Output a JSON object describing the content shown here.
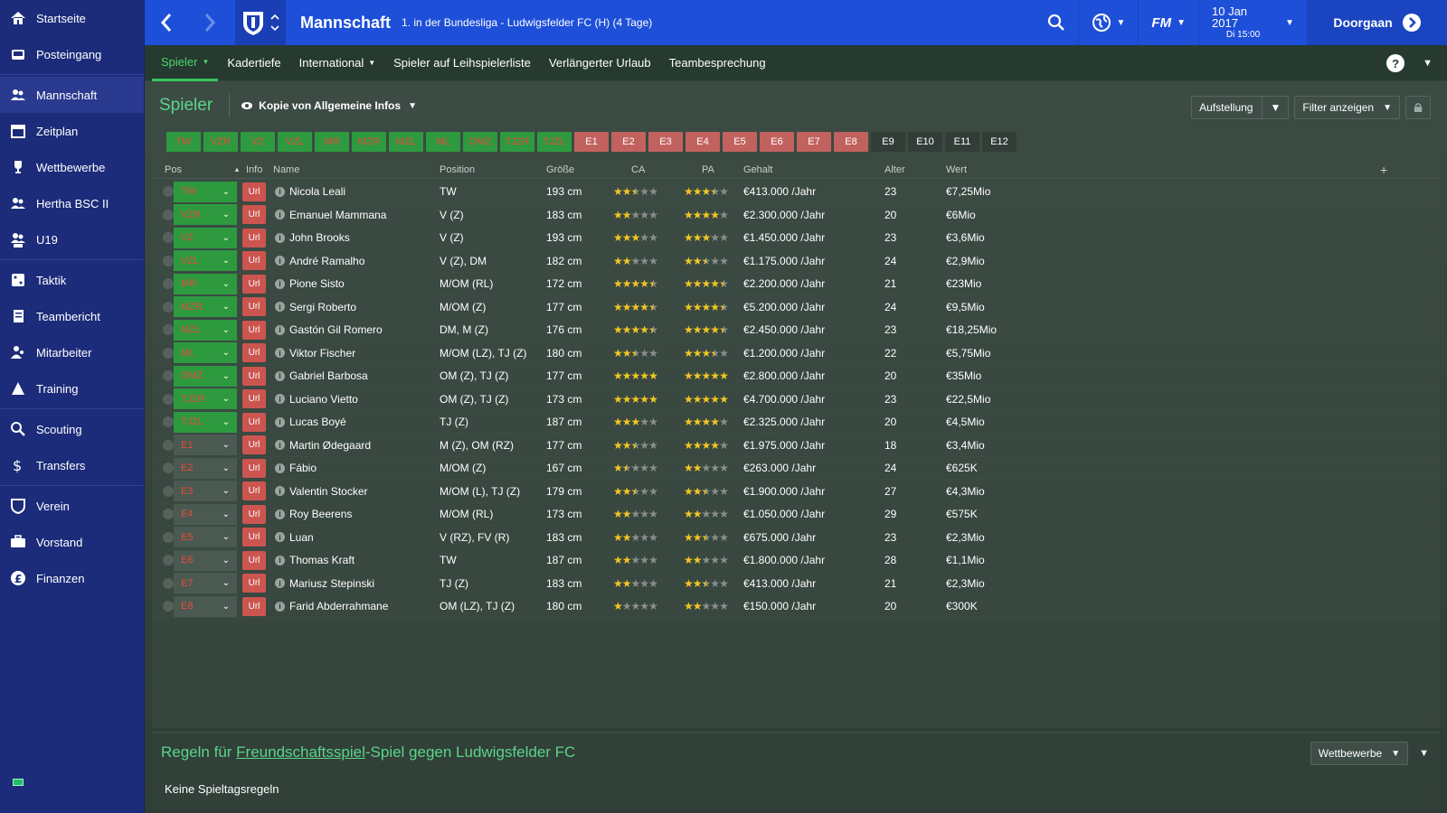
{
  "sidebar": {
    "items": [
      {
        "label": "Startseite",
        "icon": "home-icon"
      },
      {
        "label": "Posteingang",
        "icon": "inbox-icon"
      },
      {
        "label": "Mannschaft",
        "icon": "team-icon",
        "active": true
      },
      {
        "label": "Zeitplan",
        "icon": "calendar-icon"
      },
      {
        "label": "Wettbewerbe",
        "icon": "trophy-icon"
      },
      {
        "label": "Hertha BSC II",
        "icon": "team-b-icon"
      },
      {
        "label": "U19",
        "icon": "u19-icon"
      },
      {
        "label": "Taktik",
        "icon": "tactics-icon"
      },
      {
        "label": "Teambericht",
        "icon": "report-icon"
      },
      {
        "label": "Mitarbeiter",
        "icon": "staff-icon"
      },
      {
        "label": "Training",
        "icon": "training-icon"
      },
      {
        "label": "Scouting",
        "icon": "search-icon"
      },
      {
        "label": "Transfers",
        "icon": "transfers-icon"
      },
      {
        "label": "Verein",
        "icon": "club-icon"
      },
      {
        "label": "Vorstand",
        "icon": "board-icon"
      },
      {
        "label": "Finanzen",
        "icon": "finance-icon"
      }
    ]
  },
  "topbar": {
    "title": "Mannschaft",
    "subtitle": "1. in der Bundesliga - Ludwigsfelder FC (H) (4 Tage)",
    "fm_label": "FM",
    "date": "10 Jan 2017",
    "time": "Di 15:00",
    "continue_label": "Doorgaan"
  },
  "subnav": {
    "tabs": [
      {
        "label": "Spieler",
        "active": true,
        "dropdown": true
      },
      {
        "label": "Kadertiefe"
      },
      {
        "label": "International",
        "dropdown": true
      },
      {
        "label": "Spieler auf Leihspielerliste"
      },
      {
        "label": "Verlängerter Urlaub"
      },
      {
        "label": "Teambesprechung"
      }
    ],
    "help_label": "?"
  },
  "panel": {
    "title": "Spieler",
    "view_label": "Kopie von Allgemeine Infos",
    "aufstellung_label": "Aufstellung",
    "filter_label": "Filter anzeigen",
    "pos_tabs": [
      "TW",
      "VZR",
      "VZ",
      "VZL",
      "MR",
      "MZR",
      "MZL",
      "ML",
      "OMZ",
      "TJZR",
      "TJZL",
      "E1",
      "E2",
      "E3",
      "E4",
      "E5",
      "E6",
      "E7",
      "E8",
      "E9",
      "E10",
      "E11",
      "E12"
    ],
    "columns": {
      "pos": "Pos",
      "info": "Info",
      "name": "Name",
      "position": "Position",
      "groesse": "Größe",
      "ca": "CA",
      "pa": "PA",
      "gehalt": "Gehalt",
      "alter": "Alter",
      "wert": "Wert",
      "add": "+"
    }
  },
  "players": [
    {
      "pos": "TW",
      "sub": false,
      "info": "Url",
      "name": "Nicola Leali",
      "position": "TW",
      "height": "193 cm",
      "ca": 2.5,
      "pa": 3.5,
      "wage": "€413.000 /Jahr",
      "age": "23",
      "value": "€7,25Mio"
    },
    {
      "pos": "VZR",
      "sub": false,
      "info": "Url",
      "name": "Emanuel Mammana",
      "position": "V (Z)",
      "height": "183 cm",
      "ca": 2,
      "pa": 4,
      "wage": "€2.300.000 /Jahr",
      "age": "20",
      "value": "€6Mio"
    },
    {
      "pos": "VZ",
      "sub": false,
      "info": "Url",
      "name": "John Brooks",
      "position": "V (Z)",
      "height": "193 cm",
      "ca": 3,
      "pa": 3,
      "wage": "€1.450.000 /Jahr",
      "age": "23",
      "value": "€3,6Mio"
    },
    {
      "pos": "VZL",
      "sub": false,
      "info": "Url",
      "name": "André Ramalho",
      "position": "V (Z), DM",
      "height": "182 cm",
      "ca": 2,
      "pa": 2.5,
      "wage": "€1.175.000 /Jahr",
      "age": "24",
      "value": "€2,9Mio"
    },
    {
      "pos": "MR",
      "sub": false,
      "info": "Url",
      "name": "Pione Sisto",
      "position": "M/OM (RL)",
      "height": "172 cm",
      "ca": 4.5,
      "pa": 4.5,
      "wage": "€2.200.000 /Jahr",
      "age": "21",
      "value": "€23Mio"
    },
    {
      "pos": "MZR",
      "sub": false,
      "info": "Url",
      "name": "Sergi Roberto",
      "position": "M/OM (Z)",
      "height": "177 cm",
      "ca": 4.5,
      "pa": 4.5,
      "wage": "€5.200.000 /Jahr",
      "age": "24",
      "value": "€9,5Mio"
    },
    {
      "pos": "MZL",
      "sub": false,
      "info": "Url",
      "name": "Gastón Gil Romero",
      "position": "DM, M (Z)",
      "height": "176 cm",
      "ca": 4.5,
      "pa": 4.5,
      "wage": "€2.450.000 /Jahr",
      "age": "23",
      "value": "€18,25Mio"
    },
    {
      "pos": "ML",
      "sub": false,
      "info": "Url",
      "name": "Viktor Fischer",
      "position": "M/OM (LZ), TJ (Z)",
      "height": "180 cm",
      "ca": 2.5,
      "pa": 3.5,
      "wage": "€1.200.000 /Jahr",
      "age": "22",
      "value": "€5,75Mio"
    },
    {
      "pos": "OMZ",
      "sub": false,
      "info": "Url",
      "name": "Gabriel Barbosa",
      "position": "OM (Z), TJ (Z)",
      "height": "177 cm",
      "ca": 5,
      "pa": 5,
      "wage": "€2.800.000 /Jahr",
      "age": "20",
      "value": "€35Mio"
    },
    {
      "pos": "TJZR",
      "sub": false,
      "info": "Url",
      "name": "Luciano Vietto",
      "position": "OM (Z), TJ (Z)",
      "height": "173 cm",
      "ca": 5,
      "pa": 5,
      "wage": "€4.700.000 /Jahr",
      "age": "23",
      "value": "€22,5Mio"
    },
    {
      "pos": "TJZL",
      "sub": false,
      "info": "Url",
      "name": "Lucas Boyé",
      "position": "TJ (Z)",
      "height": "187 cm",
      "ca": 3,
      "pa": 4,
      "wage": "€2.325.000 /Jahr",
      "age": "20",
      "value": "€4,5Mio"
    },
    {
      "pos": "E1",
      "sub": true,
      "info": "Url",
      "name": "Martin Ødegaard",
      "position": "M (Z), OM (RZ)",
      "height": "177 cm",
      "ca": 2.5,
      "pa": 4,
      "wage": "€1.975.000 /Jahr",
      "age": "18",
      "value": "€3,4Mio"
    },
    {
      "pos": "E2",
      "sub": true,
      "info": "Url",
      "name": "Fábio",
      "position": "M/OM (Z)",
      "height": "167 cm",
      "ca": 1.5,
      "pa": 2,
      "wage": "€263.000 /Jahr",
      "age": "24",
      "value": "€625K"
    },
    {
      "pos": "E3",
      "sub": true,
      "info": "Url",
      "name": "Valentin Stocker",
      "position": "M/OM (L), TJ (Z)",
      "height": "179 cm",
      "ca": 2.5,
      "pa": 2.5,
      "wage": "€1.900.000 /Jahr",
      "age": "27",
      "value": "€4,3Mio"
    },
    {
      "pos": "E4",
      "sub": true,
      "info": "Url",
      "name": "Roy Beerens",
      "position": "M/OM (RL)",
      "height": "173 cm",
      "ca": 2,
      "pa": 2,
      "wage": "€1.050.000 /Jahr",
      "age": "29",
      "value": "€575K"
    },
    {
      "pos": "E5",
      "sub": true,
      "info": "Url",
      "name": "Luan",
      "position": "V (RZ), FV (R)",
      "height": "183 cm",
      "ca": 2,
      "pa": 2.5,
      "wage": "€675.000 /Jahr",
      "age": "23",
      "value": "€2,3Mio"
    },
    {
      "pos": "E6",
      "sub": true,
      "info": "Url",
      "name": "Thomas Kraft",
      "position": "TW",
      "height": "187 cm",
      "ca": 2,
      "pa": 2,
      "wage": "€1.800.000 /Jahr",
      "age": "28",
      "value": "€1,1Mio"
    },
    {
      "pos": "E7",
      "sub": true,
      "info": "Url",
      "name": "Mariusz Stepinski",
      "position": "TJ (Z)",
      "height": "183 cm",
      "ca": 2,
      "pa": 2.5,
      "wage": "€413.000 /Jahr",
      "age": "21",
      "value": "€2,3Mio"
    },
    {
      "pos": "E8",
      "sub": true,
      "info": "Url",
      "name": "Farid Abderrahmane",
      "position": "OM (LZ), TJ (Z)",
      "height": "180 cm",
      "ca": 1,
      "pa": 2,
      "wage": "€150.000 /Jahr",
      "age": "20",
      "value": "€300K"
    }
  ],
  "bottom": {
    "title_pre": "Regeln für ",
    "title_link": "Freundschaftsspiel",
    "title_post": "-Spiel gegen Ludwigsfelder FC",
    "text": "Keine Spieltagsregeln",
    "button": "Wettbewerbe"
  }
}
